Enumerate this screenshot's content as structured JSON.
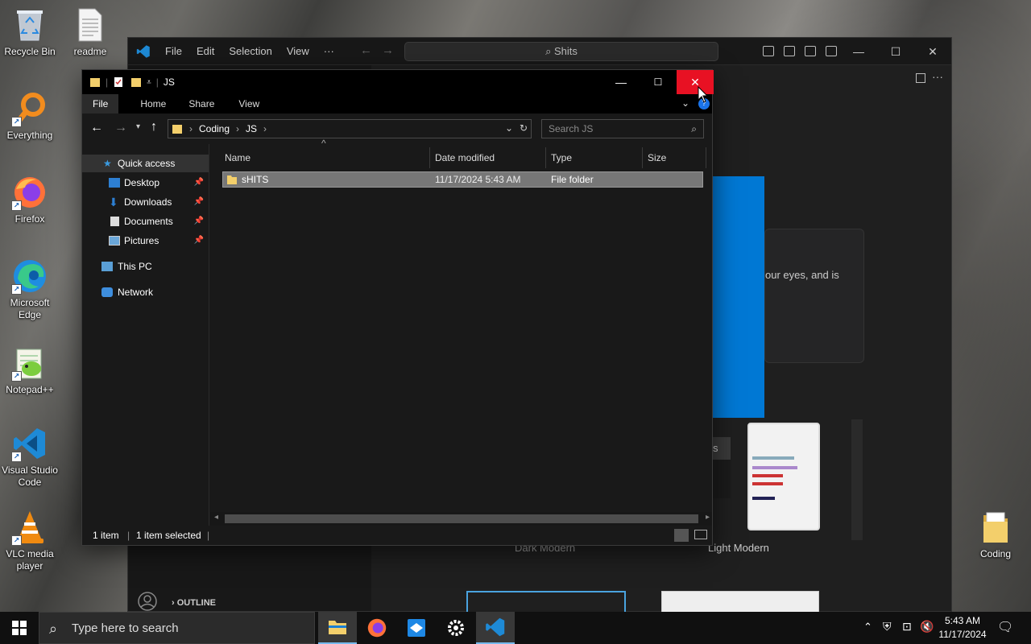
{
  "desktop": {
    "icons": [
      {
        "label": "Recycle Bin",
        "icon": "recycle-bin-icon"
      },
      {
        "label": "readme",
        "icon": "text-file-icon"
      },
      {
        "label": "Everything",
        "icon": "everything-search-icon"
      },
      {
        "label": "Firefox",
        "icon": "firefox-icon"
      },
      {
        "label": "Microsoft Edge",
        "icon": "edge-icon"
      },
      {
        "label": "Notepad++",
        "icon": "notepadplusplus-icon"
      },
      {
        "label": "Visual Studio Code",
        "icon": "vscode-icon"
      },
      {
        "label": "VLC media player",
        "icon": "vlc-icon"
      },
      {
        "label": "Coding",
        "icon": "folder-icon"
      }
    ]
  },
  "vscode": {
    "menu": [
      "File",
      "Edit",
      "Selection",
      "View",
      "···"
    ],
    "search_text": "Shits",
    "text_fragment": "our eyes, and is",
    "theme_labels": [
      "Dark Modern",
      "Light Modern"
    ],
    "outline_label": "OUTLINE",
    "partial_button": "s"
  },
  "explorer": {
    "title": "JS",
    "ribbon_tabs": [
      "File",
      "Home",
      "Share",
      "View"
    ],
    "breadcrumb": [
      "Coding",
      "JS"
    ],
    "search_placeholder": "Search JS",
    "nav": {
      "quick_access": "Quick access",
      "desktop": "Desktop",
      "downloads": "Downloads",
      "documents": "Documents",
      "pictures": "Pictures",
      "this_pc": "This PC",
      "network": "Network"
    },
    "columns": [
      "Name",
      "Date modified",
      "Type",
      "Size"
    ],
    "rows": [
      {
        "name": "sHITS",
        "date": "11/17/2024 5:43 AM",
        "type": "File folder",
        "size": ""
      }
    ],
    "status": {
      "count": "1 item",
      "selected": "1 item selected"
    }
  },
  "taskbar": {
    "search_placeholder": "Type here to search",
    "time": "5:43 AM",
    "date": "11/17/2024"
  },
  "colors": {
    "close_red": "#e81123",
    "accent_blue": "#0078d4",
    "folder_yellow": "#f3cf6b"
  }
}
